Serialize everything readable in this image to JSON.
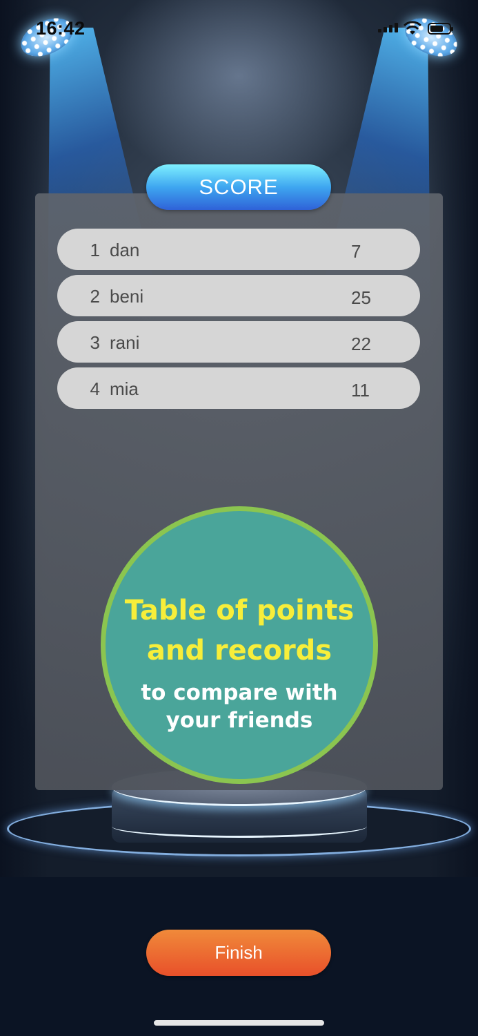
{
  "status_bar": {
    "time": "16:42"
  },
  "header": {
    "title": "SCORE"
  },
  "scoreboard": {
    "rows": [
      {
        "rank": "1",
        "name": "dan",
        "points": "7"
      },
      {
        "rank": "2",
        "name": "beni",
        "points": "25"
      },
      {
        "rank": "3",
        "name": "rani",
        "points": "22"
      },
      {
        "rank": "4",
        "name": "mia",
        "points": "11"
      }
    ]
  },
  "promo": {
    "headline_line1": "Table of points",
    "headline_line2": "and records",
    "sub_line1": "to compare with",
    "sub_line2": "your friends"
  },
  "actions": {
    "finish_label": "Finish"
  },
  "colors": {
    "score_pill": "#3ea6f0",
    "promo_fill": "#4aa59a",
    "promo_ring": "#8bc550",
    "headline_text": "#f7ee3a",
    "finish_button": "#e8502a"
  }
}
